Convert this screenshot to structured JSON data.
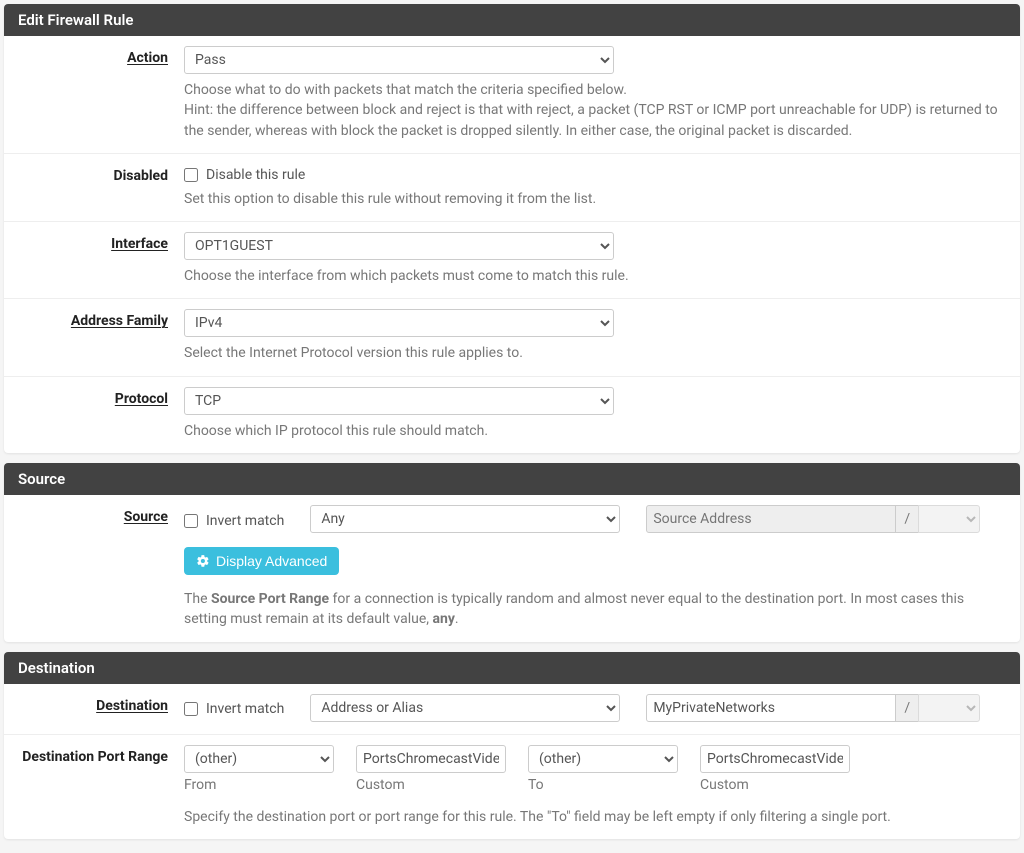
{
  "panel_edit": {
    "title": "Edit Firewall Rule"
  },
  "action": {
    "label": "Action",
    "value": "Pass",
    "help": "Choose what to do with packets that match the criteria specified below.\nHint: the difference between block and reject is that with reject, a packet (TCP RST or ICMP port unreachable for UDP) is returned to the sender, whereas with block the packet is dropped silently. In either case, the original packet is discarded."
  },
  "disabled": {
    "label": "Disabled",
    "checkbox_label": "Disable this rule",
    "help": "Set this option to disable this rule without removing it from the list."
  },
  "interface": {
    "label": "Interface",
    "value": "OPT1GUEST",
    "help": "Choose the interface from which packets must come to match this rule."
  },
  "address_family": {
    "label": "Address Family",
    "value": "IPv4",
    "help": "Select the Internet Protocol version this rule applies to."
  },
  "protocol": {
    "label": "Protocol",
    "value": "TCP",
    "help": "Choose which IP protocol this rule should match."
  },
  "panel_source": {
    "title": "Source"
  },
  "source": {
    "label": "Source",
    "invert_label": "Invert match",
    "type_value": "Any",
    "addr_placeholder": "Source Address",
    "slash": "/",
    "advanced_btn": "Display Advanced",
    "help_prefix": "The ",
    "help_bold1": "Source Port Range",
    "help_mid": " for a connection is typically random and almost never equal to the destination port. In most cases this setting must remain at its default value, ",
    "help_bold2": "any",
    "help_suffix": "."
  },
  "panel_destination": {
    "title": "Destination"
  },
  "destination": {
    "label": "Destination",
    "invert_label": "Invert match",
    "type_value": "Address or Alias",
    "addr_value": "MyPrivateNetworks",
    "slash": "/"
  },
  "dport": {
    "label": "Destination Port Range",
    "from_type": "(other)",
    "from_custom": "PortsChromecastVideos",
    "to_type": "(other)",
    "to_custom": "PortsChromecastVideos",
    "from_sub": "From",
    "custom_sub": "Custom",
    "to_sub": "To",
    "help": "Specify the destination port or port range for this rule. The \"To\" field may be left empty if only filtering a single port."
  }
}
